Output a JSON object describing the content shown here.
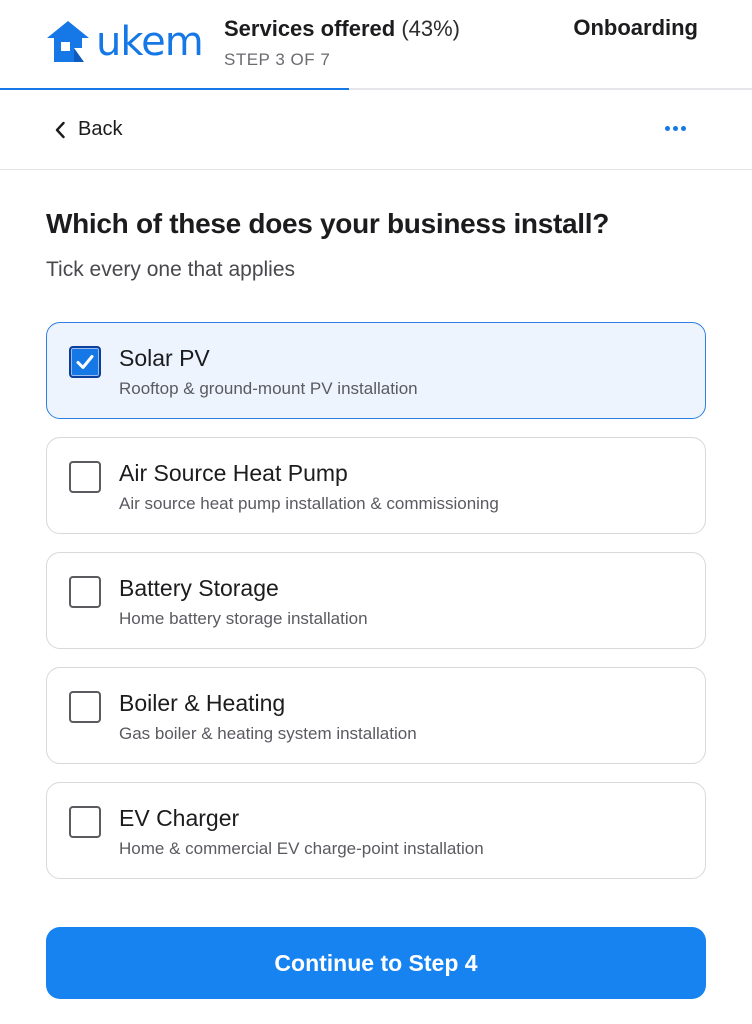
{
  "header": {
    "logo_text": "ukem",
    "title": "Services offered",
    "percent": "(43%)",
    "step": "STEP 3 OF 7",
    "context": "Onboarding",
    "progress": 0.43,
    "accent": "#1678e6"
  },
  "nav": {
    "back_label": "Back",
    "back_icon": "chevron-left-icon",
    "more_icon": "more-horizontal-icon"
  },
  "question": {
    "title": "Which of these does your business install?",
    "hint": "Tick every one that applies"
  },
  "options": [
    {
      "title": "Solar PV",
      "description": "Rooftop & ground-mount PV installation",
      "checked": true
    },
    {
      "title": "Air Source Heat Pump",
      "description": "Air source heat pump installation & commissioning",
      "checked": false
    },
    {
      "title": "Battery Storage",
      "description": "Home battery storage installation",
      "checked": false
    },
    {
      "title": "Boiler & Heating",
      "description": "Gas boiler & heating system installation",
      "checked": false
    },
    {
      "title": "EV Charger",
      "description": "Home & commercial EV charge-point installation",
      "checked": false
    }
  ],
  "footer": {
    "continue_label": "Continue to Step 4"
  }
}
